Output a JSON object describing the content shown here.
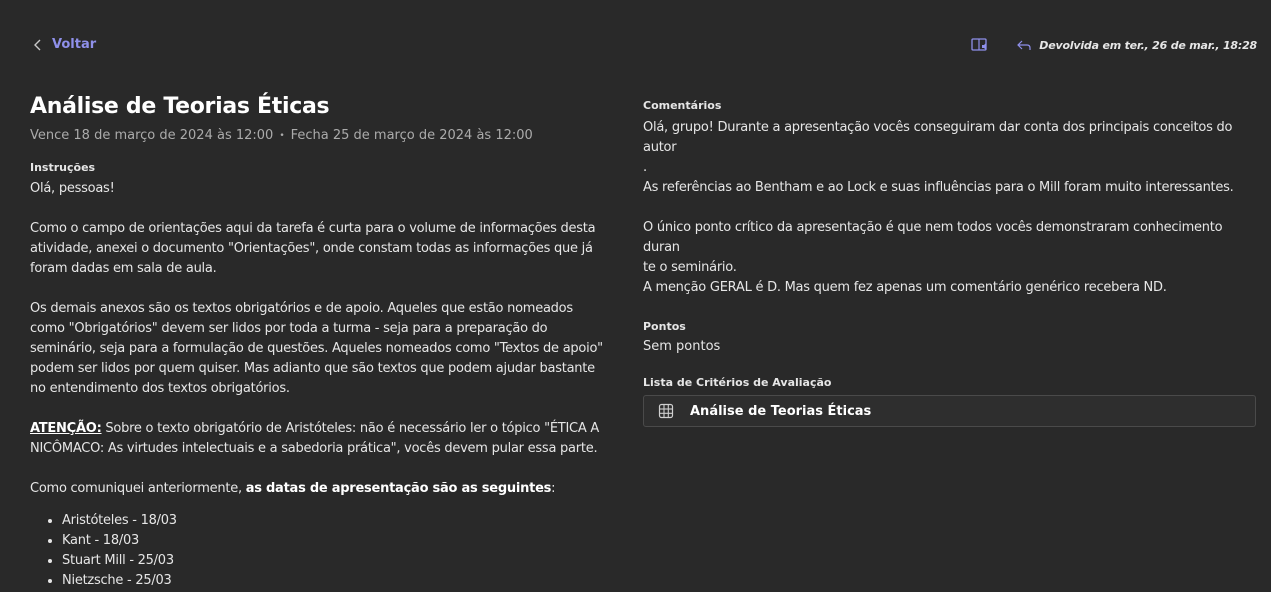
{
  "topbar": {
    "back_label": "Voltar",
    "returned_text": "Devolvida em ter., 26 de mar., 18:28"
  },
  "assignment": {
    "title": "Análise de Teorias Éticas",
    "due": "Vence 18 de março de 2024 às 12:00",
    "closes": "Fecha 25 de março de 2024 às 12:00"
  },
  "instructions": {
    "label": "Instruções",
    "greeting": "Olá, pessoas!",
    "p1": "Como o campo de orientações aqui da tarefa é curta para o volume de informações desta atividade, anexei o documento \"Orientações\", onde constam todas as informações que já foram dadas em sala de aula.",
    "p2": "Os demais anexos são os textos obrigatórios e de apoio. Aqueles que estão nomeados como \"Obrigatórios\" devem ser lidos por toda a turma - seja para a preparação do seminário, seja para a formulação de questões. Aqueles nomeados como \"Textos de apoio\" podem ser lidos por quem quiser. Mas adianto que são textos que podem ajudar bastante no entendimento dos textos obrigatórios.",
    "attention_label": "ATENÇÃO:",
    "attention_text": " Sobre o texto obrigatório de Aristóteles: não é necessário ler o tópico \"ÉTICA A NICÔMACO: As virtudes intelectuais e a sabedoria prática\", vocês devem pular essa parte.",
    "dates_intro": "Como comuniquei anteriormente, ",
    "dates_bold": "as datas de apresentação são as seguintes",
    "dates_colon": ":",
    "schedule": [
      "Aristóteles - 18/03",
      "Kant - 18/03",
      "Stuart Mill - 25/03",
      "Nietzsche - 25/03"
    ]
  },
  "feedback": {
    "comments_label": "Comentários",
    "line1": "Olá, grupo! Durante a apresentação vocês conseguiram dar conta dos principais conceitos do autor",
    "line1b": ".",
    "line2": "As referências ao Bentham e ao Lock e suas influências para o Mill foram muito interessantes.",
    "line3": "O único ponto crítico da apresentação é que nem todos vocês demonstraram conhecimento duran",
    "line3b": "te o seminário.",
    "line4": "A menção GERAL é D. Mas quem fez apenas um comentário genérico recebera ND.",
    "points_label": "Pontos",
    "points_value": "Sem pontos",
    "rubric_label": "Lista de Critérios de Avaliação",
    "rubric_name": "Análise de Teorias Éticas"
  },
  "colors": {
    "background": "#292929",
    "accent": "#8f90ea",
    "text": "#e6e6e6",
    "muted": "#ababab"
  }
}
